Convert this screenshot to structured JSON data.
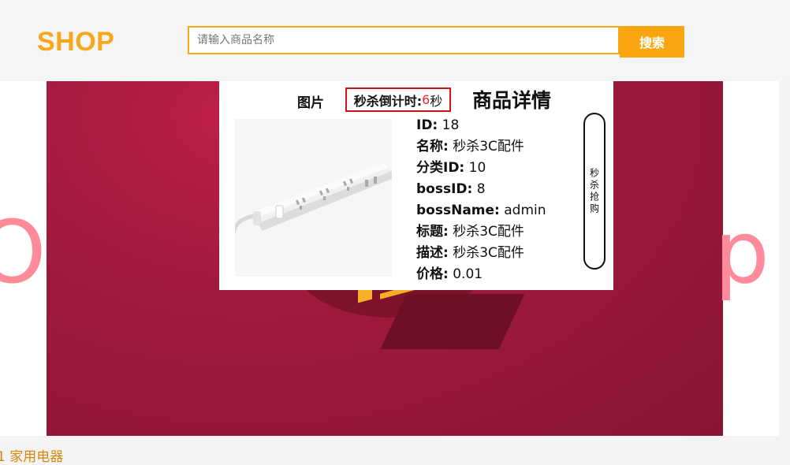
{
  "header": {
    "logo": "SHOP",
    "search_placeholder": "请输入商品名称",
    "search_button": "搜索"
  },
  "banner": {
    "left_letter": "O",
    "right_letter": "p"
  },
  "detail": {
    "picture_header": "图片",
    "countdown_label": "秒杀倒计时:",
    "countdown_value": "6",
    "countdown_unit": "秒",
    "title": "商品详情",
    "fields": [
      {
        "key": "ID:",
        "value": "18"
      },
      {
        "key": "名称:",
        "value": "秒杀3C配件"
      },
      {
        "key": "分类ID:",
        "value": "10"
      },
      {
        "key": "bossID:",
        "value": "8"
      },
      {
        "key": "bossName:",
        "value": "admin"
      },
      {
        "key": "标题:",
        "value": "秒杀3C配件"
      },
      {
        "key": "描述:",
        "value": "秒杀3C配件"
      },
      {
        "key": "价格:",
        "value": "0.01"
      }
    ],
    "buy_button": "秒杀抢购"
  },
  "footer": {
    "category_text": "1 家用电器"
  },
  "colors": {
    "accent": "#f7a71a",
    "countdown_border": "#d21414",
    "countdown_number": "#e32b2b",
    "banner": "#a01a3e"
  },
  "icons": [
    "power-strip-image"
  ]
}
